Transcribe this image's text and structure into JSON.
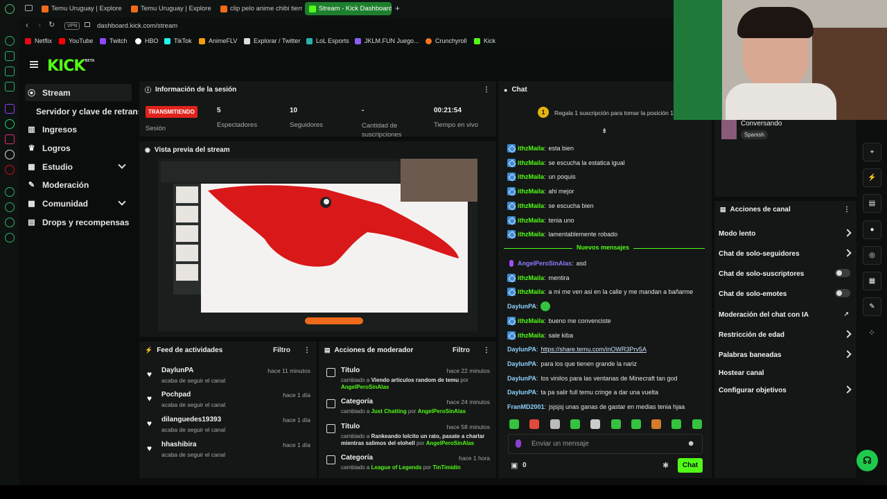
{
  "browser": {
    "tabs": [
      {
        "label": "Temu Uruguay | Explore th",
        "favicon_color": "#f06a1b"
      },
      {
        "label": "Temu Uruguay | Explore th",
        "favicon_color": "#f06a1b"
      },
      {
        "label": "clip pelo anime chibi tiern",
        "favicon_color": "#f06a1b"
      },
      {
        "label": "Stream - Kick Dashboard",
        "favicon_color": "#53fc18"
      }
    ],
    "new_tab_label": "+",
    "vpn_label": "VPN",
    "url": "dashboard.kick.com/stream",
    "bookmarks": [
      {
        "label": "Netflix",
        "color": "#e50914"
      },
      {
        "label": "YouTube",
        "color": "#ff0000"
      },
      {
        "label": "Twitch",
        "color": "#9146ff"
      },
      {
        "label": "HBO",
        "color": "#ffffff"
      },
      {
        "label": "TikTok",
        "color": "#25f4ee"
      },
      {
        "label": "AnimeFLV",
        "color": "#f29b12"
      },
      {
        "label": "Explorar / Twitter",
        "color": "#dddddd"
      },
      {
        "label": "LoL Esports",
        "color": "#2ab1ad"
      },
      {
        "label": "JKLM.FUN Juego...",
        "color": "#8b5cf6"
      },
      {
        "label": "Crunchyroll",
        "color": "#f47521"
      },
      {
        "label": "Kick",
        "color": "#53fc18"
      }
    ]
  },
  "brand": {
    "logo": "KICK",
    "beta": "BETA",
    "accent": "#53fc18",
    "live_red": "#e0241c"
  },
  "sidebar": {
    "items": [
      {
        "label": "Stream",
        "icon": "broadcast-icon"
      },
      {
        "label": "Servidor y clave de retransmisión",
        "icon": ""
      },
      {
        "label": "Ingresos",
        "icon": "chart-icon"
      },
      {
        "label": "Logros",
        "icon": "trophy-icon"
      },
      {
        "label": "Estudio",
        "icon": "studio-icon"
      },
      {
        "label": "Moderación",
        "icon": "wrench-icon"
      },
      {
        "label": "Comunidad",
        "icon": "community-icon"
      },
      {
        "label": "Drops y recompensas",
        "icon": "gift-icon"
      }
    ]
  },
  "session": {
    "title": "Información de la sesión",
    "status": "TRANSMITIENDO",
    "status_label": "Sesión",
    "viewers": "5",
    "viewers_label": "Espectadores",
    "followers": "10",
    "followers_label": "Seguidores",
    "subs": "-",
    "subs_label": "Cantidad de suscripciones",
    "uptime": "00:21:54",
    "uptime_label": "Tiempo en vivo"
  },
  "preview": {
    "title": "Vista previa del stream"
  },
  "feed": {
    "title": "Feed de actividades",
    "filter": "Filtro",
    "items": [
      {
        "name": "DaylunPA",
        "action": "acaba de seguir el canal",
        "time": "hace 11 minutos"
      },
      {
        "name": "Pochpad",
        "action": "acaba de seguir el canal",
        "time": "hace 1 día"
      },
      {
        "name": "dilanguedes19393",
        "action": "acaba de seguir el canal",
        "time": "hace 1 día"
      },
      {
        "name": "hhashibira",
        "action": "acaba de seguir el canal",
        "time": "hace 1 día"
      }
    ]
  },
  "modactions": {
    "title": "Acciones de moderador",
    "filter": "Filtro",
    "items": [
      {
        "name": "Título",
        "time": "hace 22 minutos",
        "pre": "cambiado a ",
        "value": "Viendo articulos random de temu",
        "mid": " por ",
        "by": "AngelPeroSinAlas"
      },
      {
        "name": "Categoría",
        "time": "hace 24 minutos",
        "pre": "cambiado a ",
        "value": "Just Chatting",
        "mid": " por ",
        "by": "AngelPeroSinAlas"
      },
      {
        "name": "Título",
        "time": "hace 58 minutos",
        "pre": "cambiado a ",
        "value": "Rankeando lolcito un rato, pasate a charlar mientras salimos del elohell",
        "mid": " por ",
        "by": "AngelPeroSinAlas"
      },
      {
        "name": "Categoría",
        "time": "hace 1 hora",
        "pre": "cambiado a ",
        "value": "League of Legends",
        "mid": " por ",
        "by": "TinTimidin"
      }
    ]
  },
  "chat": {
    "title": "Chat",
    "promo": "Regala 1 suscripción para tomar la posición 1",
    "promo_rank": "1",
    "new_messages": "Nuevos mensajes",
    "messages_before": [
      {
        "user": "ithzMaila",
        "text": "esta bien",
        "color": "#53fc18",
        "badge": true
      },
      {
        "user": "ithzMaila",
        "text": "se escucha la estatica igual",
        "color": "#53fc18",
        "badge": true
      },
      {
        "user": "ithzMaila",
        "text": "un poquis",
        "color": "#53fc18",
        "badge": true
      },
      {
        "user": "ithzMaila",
        "text": "ahi mejor",
        "color": "#53fc18",
        "badge": true
      },
      {
        "user": "ithzMaila",
        "text": "se escucha bien",
        "color": "#53fc18",
        "badge": true
      },
      {
        "user": "ithzMaila",
        "text": "tenia uno",
        "color": "#53fc18",
        "badge": true
      },
      {
        "user": "ithzMaila",
        "text": "lamentablemente robado",
        "color": "#53fc18",
        "badge": true
      }
    ],
    "messages_after": [
      {
        "user": "AngelPeroSinAlas",
        "text": "asd",
        "color": "#8a7dff",
        "badge": false,
        "mic": true
      },
      {
        "user": "ithzMaila",
        "text": "mentira",
        "color": "#53fc18",
        "badge": true
      },
      {
        "user": "ithzMaila",
        "text": "a mi me ven asi en la calle y me mandan a bañarme",
        "color": "#53fc18",
        "badge": true
      },
      {
        "user": "DaylunPA",
        "text": "",
        "color": "#8fd3ff",
        "badge": false,
        "emote": true
      },
      {
        "user": "ithzMaila",
        "text": "bueno me convenciste",
        "color": "#53fc18",
        "badge": true
      },
      {
        "user": "ithzMaila",
        "text": "sale kiba",
        "color": "#53fc18",
        "badge": true
      },
      {
        "user": "DaylunPA",
        "text": "https://share.temu.com/inOWR3Prv5A",
        "color": "#8fd3ff",
        "badge": false,
        "link": true
      },
      {
        "user": "DaylunPA",
        "text": "para los que tienen grande la nariz",
        "color": "#8fd3ff",
        "badge": false
      },
      {
        "user": "DaylunPA",
        "text": "los vinilos para las ventanas de Minecraft tan god",
        "color": "#8fd3ff",
        "badge": false
      },
      {
        "user": "DaylunPA",
        "text": "ta pa salir full temu cringe a dar una vuelta",
        "color": "#8fd3ff",
        "badge": false
      },
      {
        "user": "FranMD2001",
        "text": "jsjsjsj unas ganas de gastar en medias tenia hjaa",
        "color": "#8fd3ff",
        "badge": false
      }
    ],
    "placeholder": "Enviar un mensaje",
    "points": "0",
    "send_label": "Chat"
  },
  "channel": {
    "category": "Conversando",
    "language": "Spanish"
  },
  "channel_actions": {
    "title": "Acciones de canal",
    "items": [
      {
        "label": "Modo lento",
        "control": "chevron"
      },
      {
        "label": "Chat de solo-seguidores",
        "control": "chevron"
      },
      {
        "label": "Chat de solo-suscriptores",
        "control": "toggle"
      },
      {
        "label": "Chat de solo-emotes",
        "control": "toggle"
      },
      {
        "label": "Moderación del chat con IA",
        "control": "external"
      },
      {
        "label": "Restricción de edad",
        "control": "chevron"
      },
      {
        "label": "Palabras baneadas",
        "control": "chevron"
      },
      {
        "label": "Hostear canal",
        "control": "none"
      },
      {
        "label": "Configurar objetivos",
        "control": "chevron"
      }
    ]
  }
}
